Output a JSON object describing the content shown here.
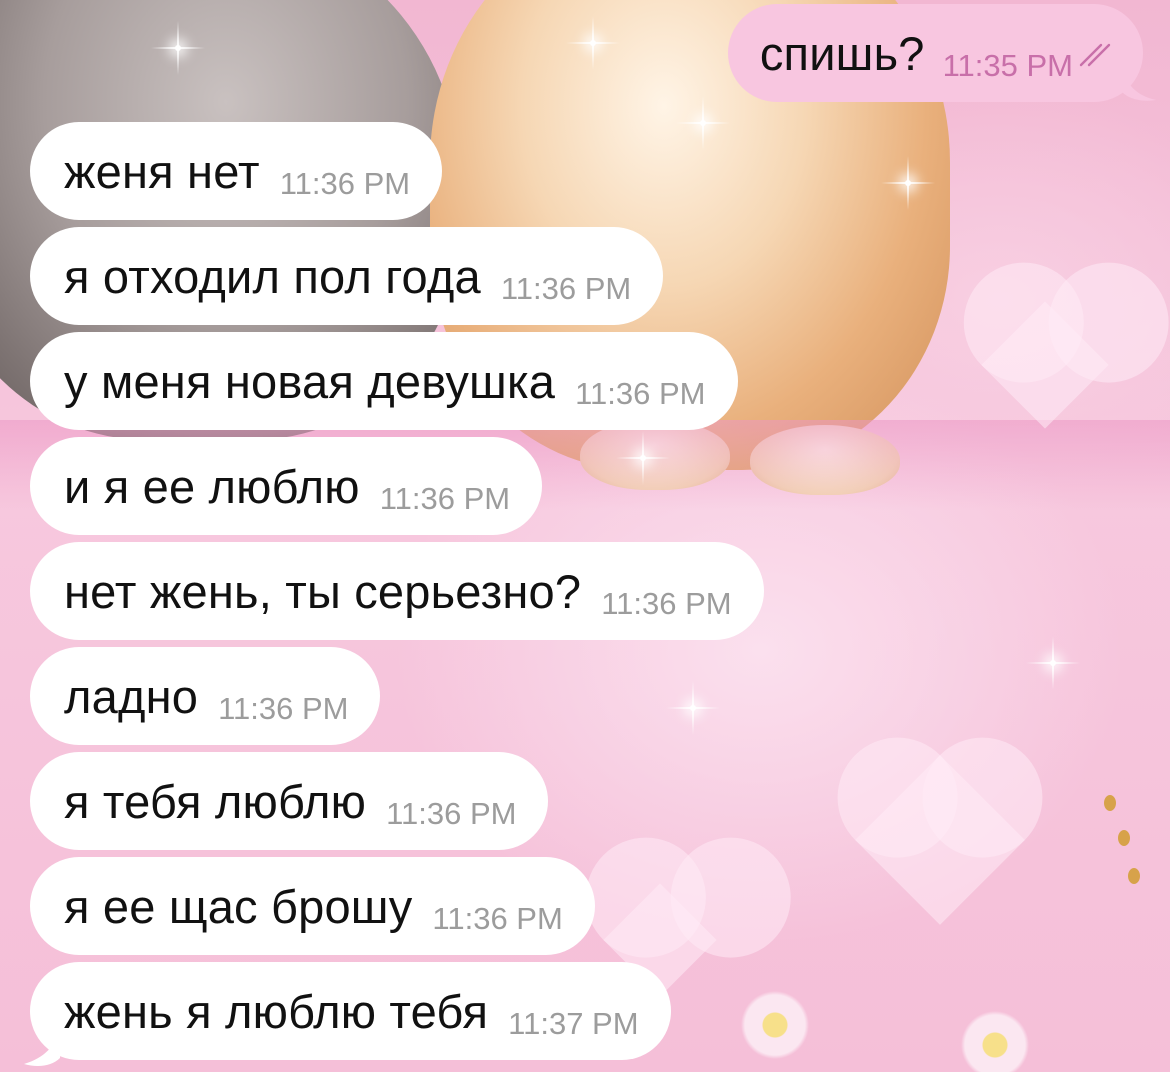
{
  "outgoing": {
    "text": "спишь?",
    "time": "11:35 PM",
    "status_icon": "double-check-icon",
    "bubble_color": "#f8c6e0",
    "time_color": "#c86fa9"
  },
  "incoming": [
    {
      "text": "женя нет",
      "time": "11:36 PM"
    },
    {
      "text": "я отходил пол года",
      "time": "11:36 PM"
    },
    {
      "text": "у меня новая девушка",
      "time": "11:36 PM"
    },
    {
      "text": "и я ее люблю",
      "time": "11:36 PM"
    },
    {
      "text": "нет жень, ты серьезно?",
      "time": "11:36 PM"
    },
    {
      "text": "ладно",
      "time": "11:36 PM"
    },
    {
      "text": "я тебя люблю",
      "time": "11:36 PM"
    },
    {
      "text": "я ее щас брошу",
      "time": "11:36 PM"
    },
    {
      "text": "жень я люблю тебя",
      "time": "11:37 PM"
    }
  ],
  "colors": {
    "incoming_bubble": "#ffffff",
    "timestamp": "#9c9c9c",
    "wallpaper": "#f6c6dc"
  }
}
